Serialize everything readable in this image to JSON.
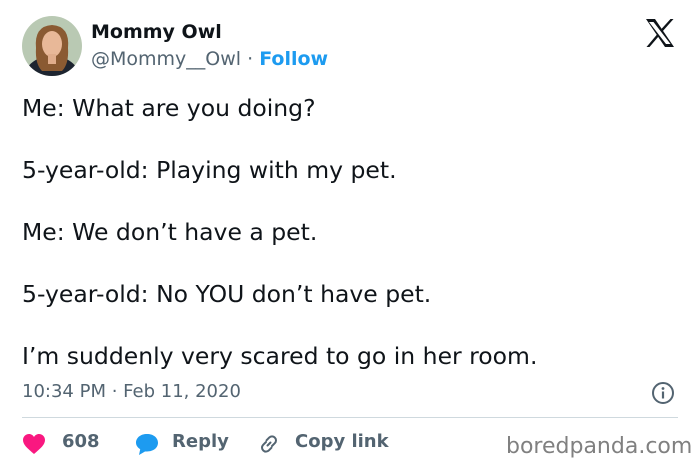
{
  "header": {
    "display_name": "Mommy Owl",
    "handle": "@Mommy__Owl",
    "separator": "·",
    "follow_label": "Follow",
    "brand_icon": "x-logo-icon"
  },
  "tweet": {
    "lines": [
      "Me: What are you doing?",
      "5-year-old: Playing with my pet.",
      "Me: We don’t have a pet.",
      "5-year-old: No YOU don’t have pet.",
      "I’m suddenly very scared to go in her room."
    ],
    "timestamp": "10:34 PM · Feb 11, 2020"
  },
  "actions": {
    "like_count": "608",
    "reply_label": "Reply",
    "copy_link_label": "Copy link"
  },
  "watermark": "boredpanda.com",
  "colors": {
    "accent": "#1d9bf0",
    "like": "#f91880",
    "secondary_text": "#536471"
  }
}
